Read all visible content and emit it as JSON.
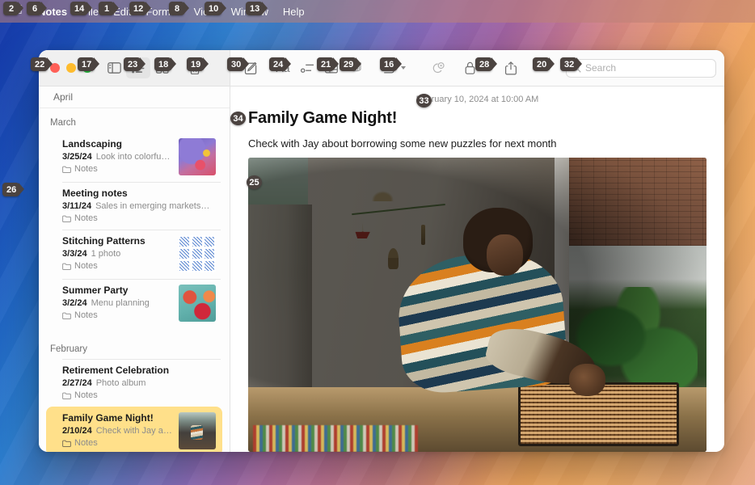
{
  "menubar": {
    "apple_icon": "apple-logo",
    "items": [
      {
        "label": "Notes",
        "badge": "6",
        "bold": true
      },
      {
        "label": "File",
        "badge": "14"
      },
      {
        "label": "Edit",
        "badge": "1"
      },
      {
        "label": "Format",
        "badge": "12"
      },
      {
        "label": "View",
        "badge": "8"
      },
      {
        "label": "Window",
        "badge": "10"
      },
      {
        "label": "Help",
        "badge": "13"
      }
    ],
    "apple_badge": "2"
  },
  "window": {
    "traffic": {
      "close": "close-button",
      "minimize": "minimize-button",
      "zoom": "zoom-button"
    },
    "badges": {
      "traffic": "22",
      "green": "17",
      "window": "26"
    }
  },
  "toolbar": {
    "sidebar_toggle": "sidebar-toggle",
    "list_view": "list-view",
    "gallery_view": "gallery-view",
    "delete": "delete-note",
    "compose": "compose-note",
    "format": "Aa",
    "checklist": "checklist",
    "table": "table",
    "markup": "markup",
    "media": "media",
    "collaborate": "collaborate",
    "lock": "lock-note",
    "share": "share-note",
    "badges": {
      "sidebar": "23",
      "gallery": "18",
      "delete": "19",
      "compose": "30",
      "format": "24",
      "checklist": "21",
      "table": "29",
      "markup": "16",
      "collaborate": "28",
      "lock": "20",
      "share": "32",
      "toolbar_left": "17"
    }
  },
  "search": {
    "placeholder": "Search",
    "value": "",
    "icon": "search-icon"
  },
  "sidebar": {
    "pinned_label": "April",
    "groups": [
      {
        "label": "March",
        "notes": [
          {
            "title": "Landscaping",
            "date": "3/25/24",
            "preview": "Look into colorfu…",
            "folder": "Notes",
            "thumb": "iris-flower",
            "selected": false
          },
          {
            "title": "Meeting notes",
            "date": "3/11/24",
            "preview": "Sales in emerging markets…",
            "folder": "Notes",
            "thumb": "",
            "selected": false
          },
          {
            "title": "Stitching Patterns",
            "date": "3/3/24",
            "preview": "1 photo",
            "folder": "Notes",
            "thumb": "stitch-grid",
            "selected": false
          },
          {
            "title": "Summer Party",
            "date": "3/2/24",
            "preview": "Menu planning",
            "folder": "Notes",
            "thumb": "food-plate",
            "selected": false
          }
        ]
      },
      {
        "label": "February",
        "notes": [
          {
            "title": "Retirement Celebration",
            "date": "2/27/24",
            "preview": "Photo album",
            "folder": "Notes",
            "thumb": "",
            "selected": false
          },
          {
            "title": "Family Game Night!",
            "date": "2/10/24",
            "preview": "Check with Jay a…",
            "folder": "Notes",
            "thumb": "boy-puzzle",
            "selected": true
          }
        ]
      }
    ]
  },
  "note": {
    "date": "February 10, 2024 at 10:00 AM",
    "title": "Family Game Night!",
    "body": "Check with Jay about borrowing some new puzzles for next month",
    "photo_alt": "boy-at-table-with-puzzle",
    "badges": {
      "date": "33",
      "title": "34",
      "photo": "25"
    }
  },
  "colors": {
    "selection": "#ffe08a",
    "badge": "#4b4340",
    "accent": "#f0a862"
  }
}
